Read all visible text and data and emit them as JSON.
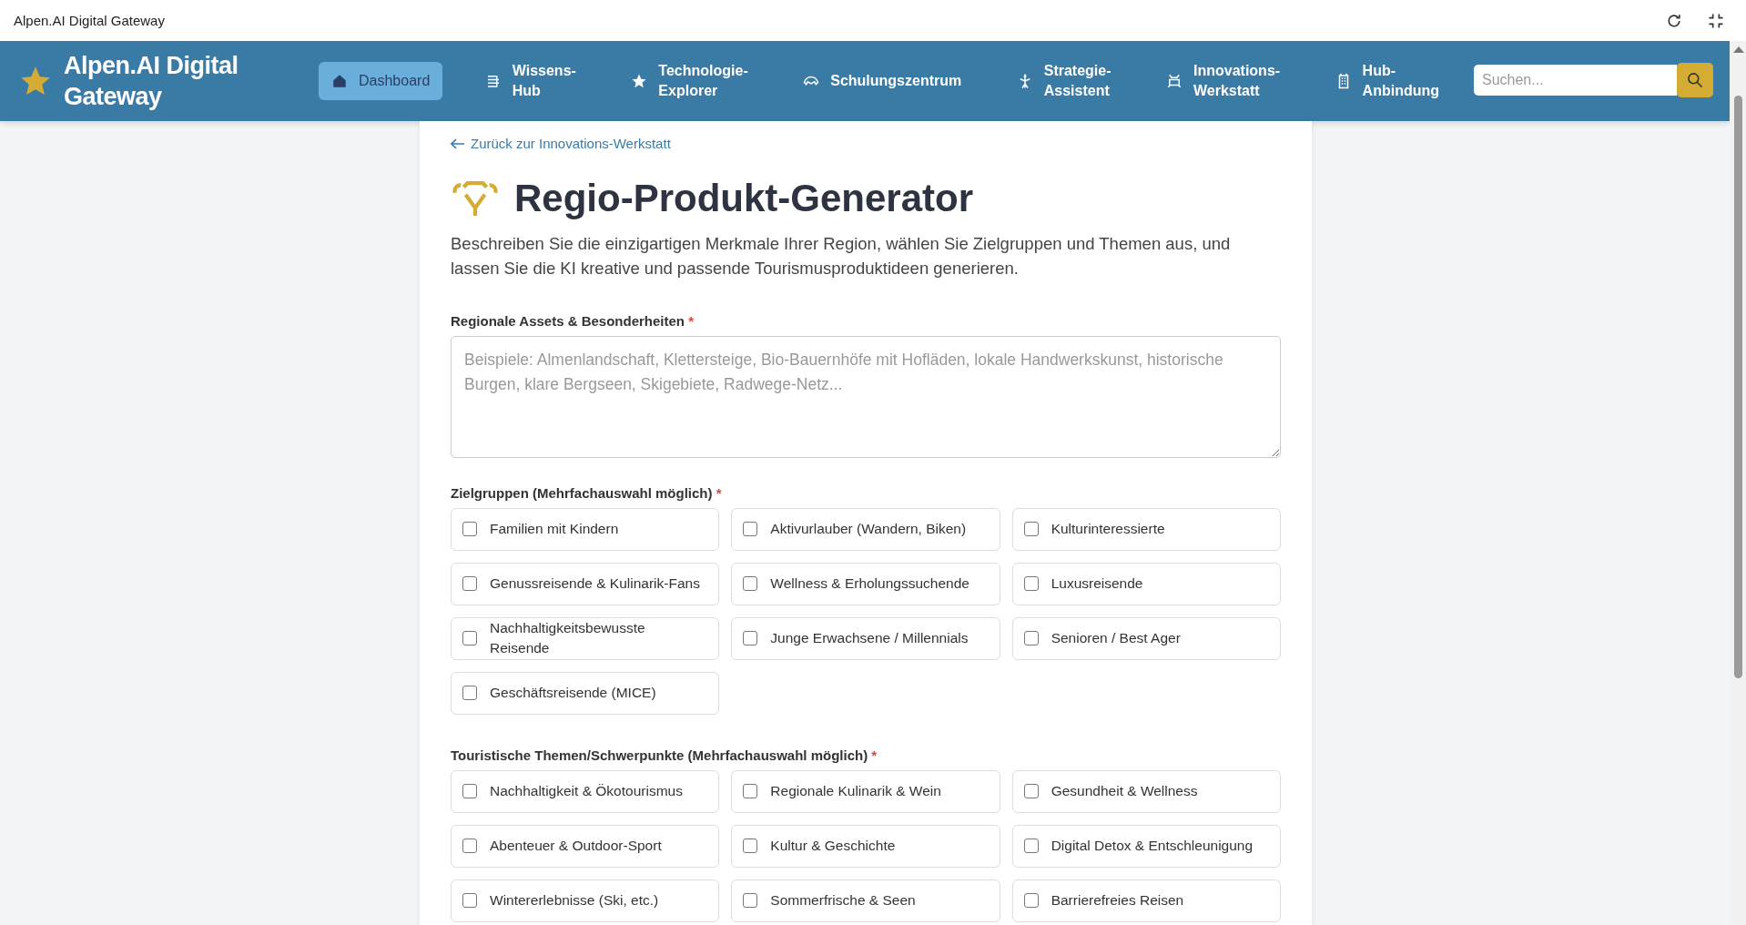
{
  "window": {
    "title": "Alpen.AI Digital Gateway"
  },
  "brand": {
    "name": "Alpen.AI Digital Gateway"
  },
  "nav": [
    {
      "label": "Dashboard",
      "selected": true
    },
    {
      "label": "Wissens-Hub",
      "selected": false
    },
    {
      "label": "Technologie-Explorer",
      "selected": false
    },
    {
      "label": "Schulungszentrum",
      "selected": false
    },
    {
      "label": "Strategie-Assistent",
      "selected": false
    },
    {
      "label": "Innovations-Werkstatt",
      "selected": false
    },
    {
      "label": "Hub-Anbindung",
      "selected": false
    }
  ],
  "search": {
    "placeholder": "Suchen..."
  },
  "back_link": "Zurück zur Innovations-Werkstatt",
  "title": "Regio-Produkt-Generator",
  "intro": "Beschreiben Sie die einzigartigen Merkmale Ihrer Region, wählen Sie Zielgruppen und Themen aus, und lassen Sie die KI kreative und passende Tourismusproduktideen generieren.",
  "assets": {
    "label": "Regionale Assets & Besonderheiten",
    "required_mark": "*",
    "placeholder": "Beispiele: Almenlandschaft, Klettersteige, Bio-Bauernhöfe mit Hofläden, lokale Handwerkskunst, historische Burgen, klare Bergseen, Skigebiete, Radwege-Netz..."
  },
  "groups": [
    {
      "label": "Zielgruppen (Mehrfachauswahl möglich)",
      "required_mark": "*",
      "options": [
        {
          "label": "Familien mit Kindern",
          "checked": false
        },
        {
          "label": "Aktivurlauber (Wandern, Biken)",
          "checked": false
        },
        {
          "label": "Kulturinteressierte",
          "checked": false
        },
        {
          "label": "Genussreisende & Kulinarik-Fans",
          "checked": false
        },
        {
          "label": "Wellness & Erholungssuchende",
          "checked": false
        },
        {
          "label": "Luxusreisende",
          "checked": false
        },
        {
          "label": "Nachhaltigkeitsbewusste Reisende",
          "checked": false
        },
        {
          "label": "Junge Erwachsene / Millennials",
          "checked": false
        },
        {
          "label": "Senioren / Best Ager",
          "checked": false
        },
        {
          "label": "Geschäftsreisende (MICE)",
          "checked": false
        }
      ]
    },
    {
      "label": "Touristische Themen/Schwerpunkte (Mehrfachauswahl möglich)",
      "required_mark": "*",
      "options": [
        {
          "label": "Nachhaltigkeit & Ökotourismus",
          "checked": false
        },
        {
          "label": "Regionale Kulinarik & Wein",
          "checked": false
        },
        {
          "label": "Gesundheit & Wellness",
          "checked": false
        },
        {
          "label": "Abenteuer & Outdoor-Sport",
          "checked": false
        },
        {
          "label": "Kultur & Geschichte",
          "checked": false
        },
        {
          "label": "Digital Detox & Entschleunigung",
          "checked": false
        },
        {
          "label": "Wintererlebnisse (Ski, etc.)",
          "checked": false
        },
        {
          "label": "Sommerfrische & Seen",
          "checked": false
        },
        {
          "label": "Barrierefreies Reisen",
          "checked": false
        }
      ]
    }
  ]
}
